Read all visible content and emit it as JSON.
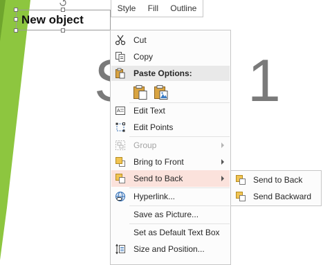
{
  "slide": {
    "title_left": "S",
    "title_right": "1",
    "textbox_text": "New object"
  },
  "mini_toolbar": {
    "style": "Style",
    "fill": "Fill",
    "outline": "Outline"
  },
  "context_menu": {
    "cut": "Cut",
    "copy": "Copy",
    "paste_options": "Paste Options:",
    "edit_text": "Edit Text",
    "edit_points": "Edit Points",
    "group": "Group",
    "bring_to_front": "Bring to Front",
    "send_to_back": "Send to Back",
    "hyperlink": "Hyperlink...",
    "save_as_picture": "Save as Picture...",
    "set_default_text_box": "Set as Default Text Box",
    "size_and_position": "Size and Position..."
  },
  "submenu": {
    "send_to_back": "Send to Back",
    "send_backward": "Send Backward"
  },
  "colors": {
    "accent_green": "#8dc63f",
    "hover": "#fbe2dc",
    "title_gray": "#7a7a7a"
  },
  "icons": [
    "cut-icon",
    "copy-icon",
    "paste-icon",
    "paste-keep-formatting-icon",
    "paste-picture-icon",
    "edit-text-icon",
    "edit-points-icon",
    "group-icon",
    "bring-to-front-icon",
    "send-to-back-icon",
    "hyperlink-icon",
    "size-position-icon",
    "send-backward-icon"
  ]
}
